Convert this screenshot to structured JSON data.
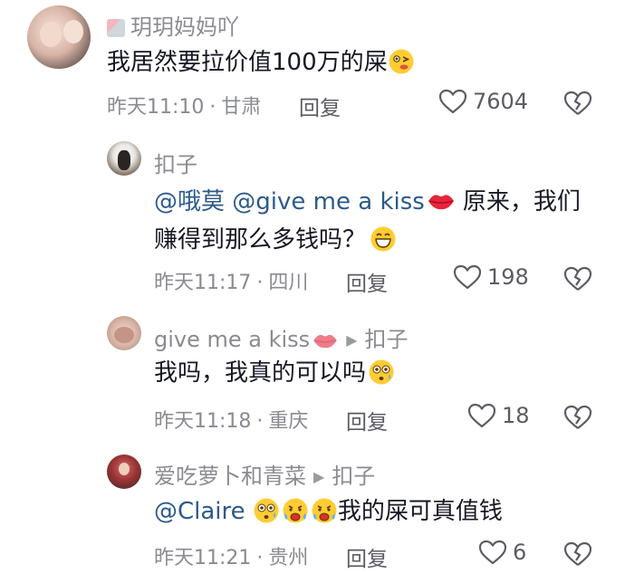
{
  "comments": [
    {
      "username": "玥玥妈妈吖",
      "text": "我居然要拉价值100万的屎",
      "time": "昨天11:10",
      "location": "甘肃",
      "reply_label": "回复",
      "likes": "7604"
    },
    {
      "username": "扣子",
      "mention1": "@哦莫",
      "mention2": "@give me a kiss",
      "text_line1": "原来，我们",
      "text_line2": "赚得到那么多钱吗？",
      "time": "昨天11:17",
      "location": "四川",
      "reply_label": "回复",
      "likes": "198"
    },
    {
      "username": "give me a kiss",
      "reply_to": "扣子",
      "text": "我吗，我真的可以吗",
      "time": "昨天11:18",
      "location": "重庆",
      "reply_label": "回复",
      "likes": "18"
    },
    {
      "username": "爱吃萝卜和青菜",
      "reply_to": "扣子",
      "mention": "@Claire",
      "text": "我的屎可真值钱",
      "time": "昨天11:21",
      "location": "贵州",
      "reply_label": "回复",
      "likes": "6"
    }
  ],
  "meta_separator": "·",
  "icons": {
    "like": "heart-outline-icon",
    "dislike": "broken-heart-icon",
    "reply_arrow": "play-arrow-icon",
    "lips": "lips-icon"
  },
  "colors": {
    "mention": "#2b5a8b",
    "meta": "#8a8b91",
    "text": "#161823"
  }
}
